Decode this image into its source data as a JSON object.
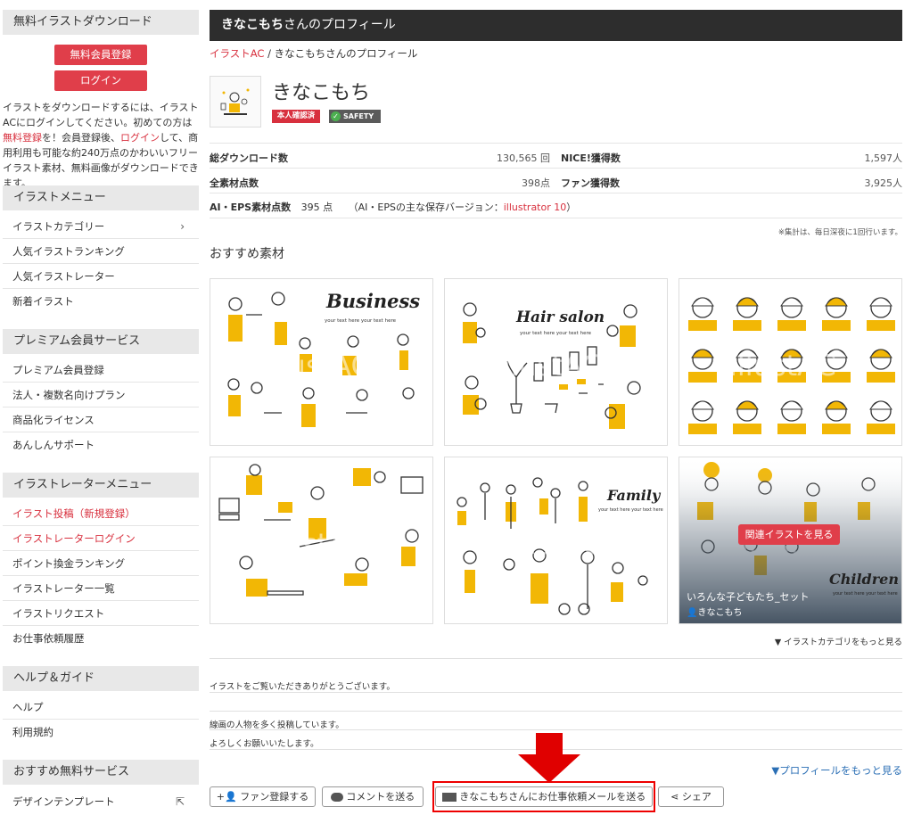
{
  "sidebar": {
    "download_head": "無料イラストダウンロード",
    "register_btn": "無料会員登録",
    "login_btn": "ログイン",
    "desc": {
      "p1": "イラストをダウンロードするには、イラストACにログインしてください。初めての方は",
      "l1": "無料登録",
      "p2": "を！会員登録後、",
      "l2": "ログイン",
      "p3": "して、商用利用も可能な約240万点のかわいいフリーイラスト素材、無料画像がダウンロードできます。"
    },
    "menu_head": "イラストメニュー",
    "menu_items": [
      "イラストカテゴリー",
      "人気イラストランキング",
      "人気イラストレーター",
      "新着イラスト"
    ],
    "premium_head": "プレミアム会員サービス",
    "premium_items": [
      "プレミアム会員登録",
      "法人・複数名向けプラン",
      "商品化ライセンス",
      "あんしんサポート"
    ],
    "creator_head": "イラストレーターメニュー",
    "creator_items": [
      "イラスト投稿（新規登録）",
      "イラストレーターログイン",
      "ポイント換金ランキング",
      "イラストレーター一覧",
      "イラストリクエスト",
      "お仕事依頼履歴"
    ],
    "help_head": "ヘルプ＆ガイド",
    "help_items": [
      "ヘルプ",
      "利用規約"
    ],
    "reco_head": "おすすめ無料サービス",
    "reco_items": [
      "デザインテンプレート"
    ]
  },
  "profile": {
    "title_name": "きなこもち",
    "title_suffix": "さんのプロフィール",
    "breadcrumb_home": "イラストAC",
    "breadcrumb_sep": "/",
    "breadcrumb_current": "きなこもちさんのプロフィール",
    "username": "きなこもち",
    "badge_verified": "本人確認済",
    "badge_safety": "SAFETY"
  },
  "stats": {
    "downloads_label": "総ダウンロード数",
    "downloads_value": "130,565 回",
    "nice_label": "NICE!獲得数",
    "nice_value": "1,597人",
    "items_label": "全素材点数",
    "items_value": "398点",
    "fans_label": "ファン獲得数",
    "fans_value": "3,925人",
    "ai_label": "AI・EPS素材点数",
    "ai_value": "395 点",
    "ai_note_pre": "（AI・EPSの主な保存バージョン：",
    "ai_note_ver": "illustrator 10",
    "ai_note_post": "）",
    "note": "※集計は、毎日深夜に1回行います。"
  },
  "recommended": {
    "title": "おすすめ素材",
    "thumbs": [
      {
        "text": "Business",
        "sub": "your text here your text here"
      },
      {
        "text": "Hair salon",
        "sub": "your text here your text here"
      },
      {
        "text": "",
        "sub": ""
      },
      {
        "text": "",
        "sub": ""
      },
      {
        "text": "Family",
        "sub": "your text here your text here"
      },
      {
        "text": "Children",
        "sub": "your text here your text here"
      }
    ],
    "watermark": "illustAC",
    "overlay_btn": "関連イラストを見る",
    "overlay_title": "いろんな子どもたち_セット",
    "overlay_author": "きなこもち",
    "more_categories": "▼ イラストカテゴリをもっと見る"
  },
  "message": {
    "thanks": "イラストをご覧いただきありがとうございます。",
    "line2": "線画の人物を多く投稿しています。",
    "line3": "よろしくお願いいたします。",
    "more_profile": "▼プロフィールをもっと見る"
  },
  "actions": {
    "fan": "ファン登録する",
    "comment": "コメントを送る",
    "request": "きなこもちさんにお仕事依頼メールを送る",
    "share": "シェア"
  },
  "colors": {
    "accent": "#e03e4a",
    "title_bar": "#2d2d2d",
    "illustration_yellow": "#f2b705",
    "link_blue": "#2b6fb5",
    "highlight_red": "#e00000"
  }
}
